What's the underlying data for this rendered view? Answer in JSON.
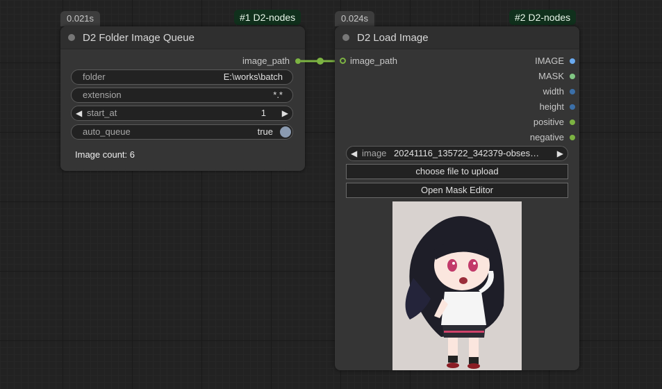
{
  "node1": {
    "time": "0.021s",
    "badge": "#1 D2-nodes",
    "title": "D2 Folder Image Queue",
    "output": "image_path",
    "widgets": {
      "folder": {
        "label": "folder",
        "value": "E:\\works\\batch"
      },
      "extension": {
        "label": "extension",
        "value": "*.*"
      },
      "start_at": {
        "label": "start_at",
        "value": "1"
      },
      "auto_queue": {
        "label": "auto_queue",
        "value": "true"
      }
    },
    "info": "Image count: 6"
  },
  "node2": {
    "time": "0.024s",
    "badge": "#2 D2-nodes",
    "title": "D2 Load Image",
    "input": "image_path",
    "outputs": [
      {
        "label": "IMAGE",
        "color": "#6aaaf0"
      },
      {
        "label": "MASK",
        "color": "#81c784"
      },
      {
        "label": "width",
        "color": "#3b6fa8"
      },
      {
        "label": "height",
        "color": "#3b6fa8"
      },
      {
        "label": "positive",
        "color": "#7cb342"
      },
      {
        "label": "negative",
        "color": "#7cb342"
      }
    ],
    "image_widget": {
      "label": "image",
      "value": "20241116_135722_342379-obses…"
    },
    "upload_button": "choose file to upload",
    "mask_button": "Open Mask Editor"
  },
  "link_color": "#7cb342",
  "icons": {
    "left": "◀",
    "right": "▶"
  }
}
